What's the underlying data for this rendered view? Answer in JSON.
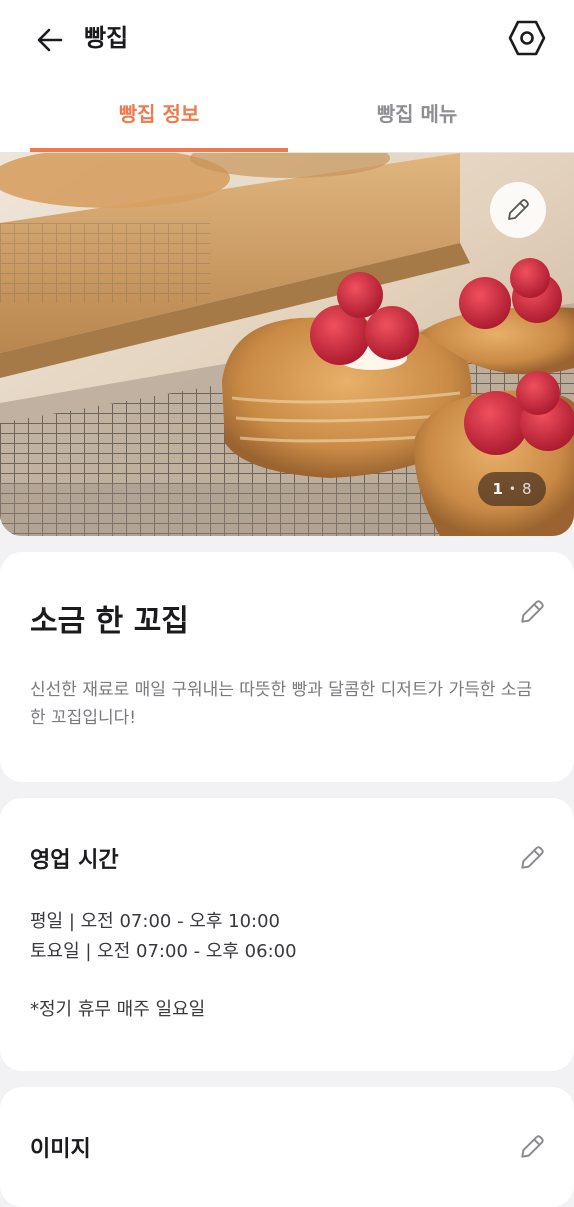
{
  "header": {
    "title": "빵집",
    "back_icon": "arrow-left-icon",
    "settings_icon": "hexagon-settings-icon"
  },
  "tabs": [
    {
      "label": "빵집 정보",
      "active": true
    },
    {
      "label": "빵집 메뉴",
      "active": false
    }
  ],
  "hero": {
    "current": "1",
    "separator": "•",
    "total": "8",
    "edit_icon": "pencil-icon"
  },
  "shop": {
    "name": "소금 한 꼬집",
    "description": "신선한 재료로 매일 구워내는 따뜻한 빵과 달콤한 디저트가 가득한 소금 한 꼬집입니다!"
  },
  "hours": {
    "title": "영업 시간",
    "weekday": "평일 | 오전 07:00 - 오후 10:00",
    "saturday": "토요일 | 오전 07:00 - 오후 06:00",
    "note": "*정기 휴무 매주 일요일"
  },
  "images": {
    "title": "이미지"
  },
  "colors": {
    "accent": "#ef7a4e",
    "inactive_tab": "#8e8e93",
    "background": "#f2f2f4"
  }
}
